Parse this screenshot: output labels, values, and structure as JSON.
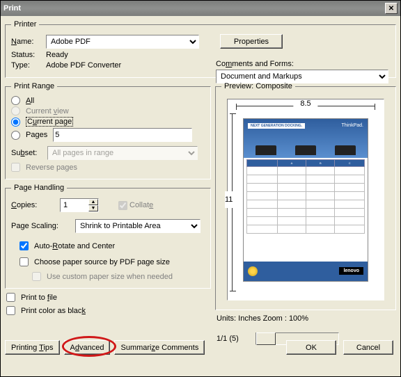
{
  "window": {
    "title": "Print"
  },
  "printer": {
    "legend": "Printer",
    "name_label": "Name:",
    "name_value": "Adobe PDF",
    "status_label": "Status:",
    "status_value": "Ready",
    "type_label": "Type:",
    "type_value": "Adobe PDF Converter",
    "properties_btn": "Properties",
    "comments_label": "Comments and Forms:",
    "comments_value": "Document and Markups"
  },
  "range": {
    "legend": "Print Range",
    "all": "All",
    "current_view": "Current view",
    "current_page": "Current page",
    "pages": "Pages",
    "pages_value": "5",
    "subset_label": "Subset:",
    "subset_value": "All pages in range",
    "reverse": "Reverse pages"
  },
  "handling": {
    "legend": "Page Handling",
    "copies_label": "Copies:",
    "copies_value": "1",
    "collate": "Collate",
    "scaling_label": "Page Scaling:",
    "scaling_value": "Shrink to Printable Area",
    "auto_rotate": "Auto-Rotate and Center",
    "choose_paper": "Choose paper source by PDF page size",
    "custom_paper": "Use custom paper size when needed"
  },
  "options": {
    "print_to_file": "Print to file",
    "print_color_black": "Print color as black"
  },
  "preview": {
    "legend": "Preview: Composite",
    "width": "8.5",
    "height": "11",
    "units": "Units: Inches",
    "zoom": "Zoom : 100%",
    "page_info": "1/1 (5)",
    "doc_headline": "NEXT GENERATION DOCKING.",
    "doc_brand": "ThinkPad.",
    "doc_logo": "lenovo"
  },
  "footer": {
    "printing_tips": "Printing Tips",
    "advanced": "Advanced",
    "summarize": "Summarize Comments",
    "ok": "OK",
    "cancel": "Cancel"
  }
}
